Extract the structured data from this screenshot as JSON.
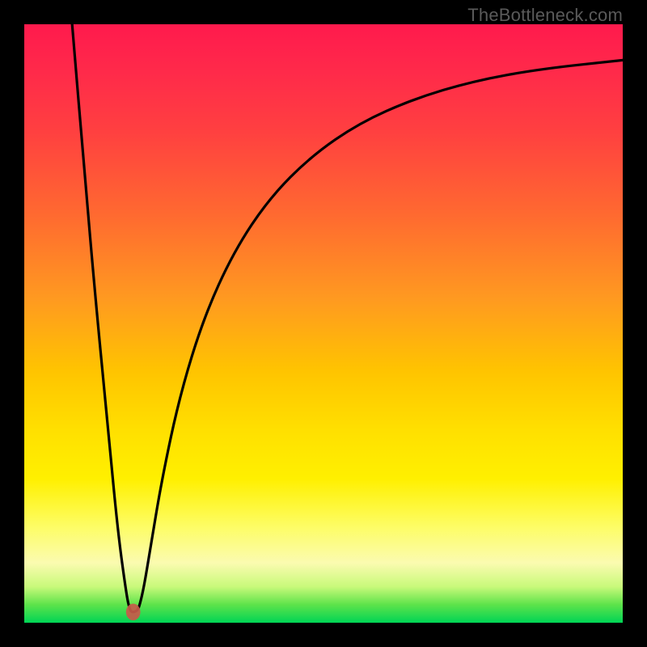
{
  "attribution": "TheBottleneck.com",
  "chart_data": {
    "type": "line",
    "title": "",
    "xlabel": "",
    "ylabel": "",
    "xlim": [
      0,
      100
    ],
    "ylim": [
      0,
      100
    ],
    "grid": false,
    "legend": false,
    "series": [
      {
        "name": "bottleneck-curve",
        "x": [
          8,
          10,
          12,
          14,
          15.6,
          17.1,
          17.6,
          18.0,
          18.9,
          19.3,
          20.0,
          21.0,
          23.0,
          26.0,
          30.0,
          35.0,
          41.0,
          48.0,
          56.0,
          65.0,
          75.0,
          86.0,
          100.0
        ],
        "values": [
          100.0,
          76.0,
          53.0,
          32.5,
          15.5,
          4.5,
          2.3,
          1.7,
          2.0,
          3.0,
          6.0,
          12.0,
          24.0,
          38.0,
          51.0,
          62.0,
          71.0,
          78.0,
          83.5,
          87.5,
          90.5,
          92.5,
          94.0
        ]
      }
    ],
    "notch": {
      "x": 18.2,
      "y": 1.8,
      "rx": 1.2,
      "ry": 1.4
    },
    "background_gradient_stops": [
      {
        "pos": 0.0,
        "color": "#ff1a4d"
      },
      {
        "pos": 0.18,
        "color": "#ff4040"
      },
      {
        "pos": 0.46,
        "color": "#ff9a20"
      },
      {
        "pos": 0.68,
        "color": "#ffe000"
      },
      {
        "pos": 0.9,
        "color": "#fbfbb0"
      },
      {
        "pos": 1.0,
        "color": "#00d455"
      }
    ]
  }
}
